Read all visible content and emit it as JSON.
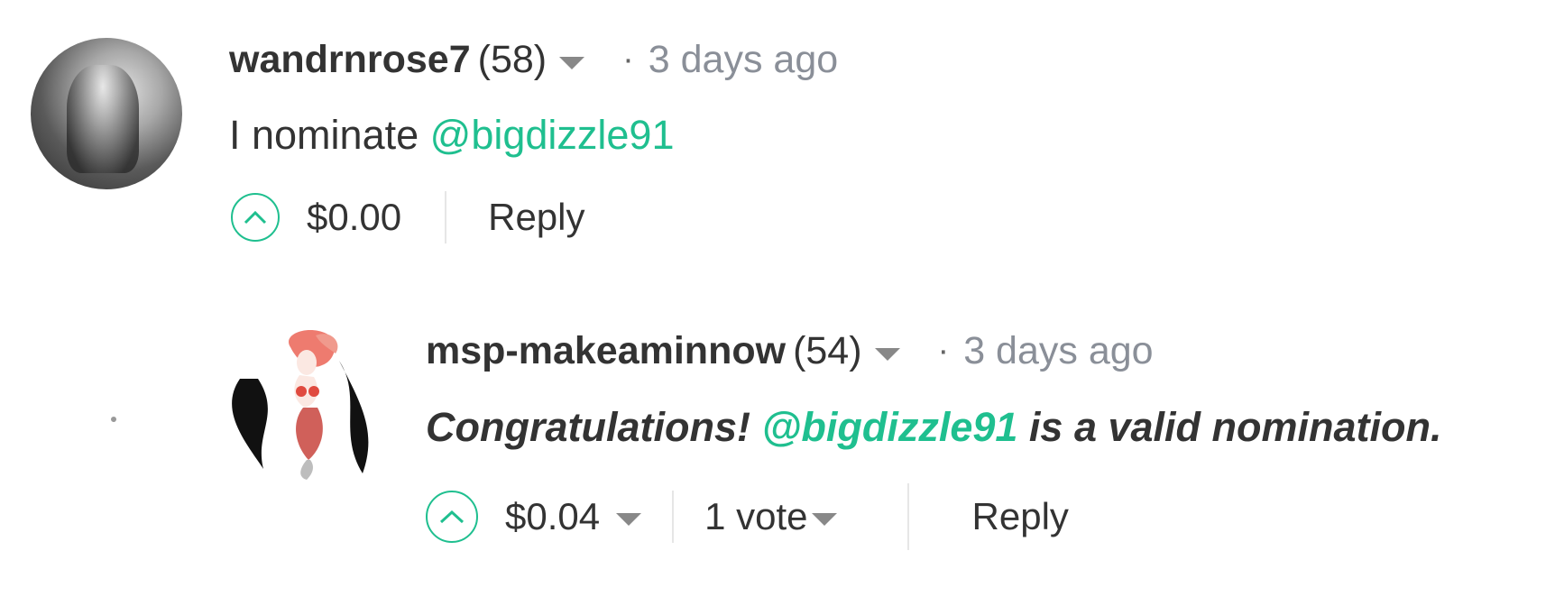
{
  "comments": [
    {
      "author": "wandrnrose7",
      "reputation": "(58)",
      "separator": "·",
      "time": "3 days ago",
      "body_prefix": "I nominate ",
      "body_mention": "@bigdizzle91",
      "payout": "$0.00",
      "reply_label": "Reply",
      "avatar_icon": "user-avatar-photo",
      "upvote_icon": "chevron-up-icon"
    },
    {
      "author": "msp-makeaminnow",
      "reputation": "(54)",
      "separator": "·",
      "time": "3 days ago",
      "body_prefix": "Congratulations! ",
      "body_mention": "@bigdizzle91",
      "body_suffix": " is a valid nomination.",
      "payout": "$0.04",
      "votes": "1 vote",
      "reply_label": "Reply",
      "avatar_icon": "mermaid-steem-logo",
      "upvote_icon": "chevron-up-icon"
    }
  ],
  "colors": {
    "accent": "#1fbf8f",
    "text": "#333333",
    "muted": "#8a8f98"
  }
}
